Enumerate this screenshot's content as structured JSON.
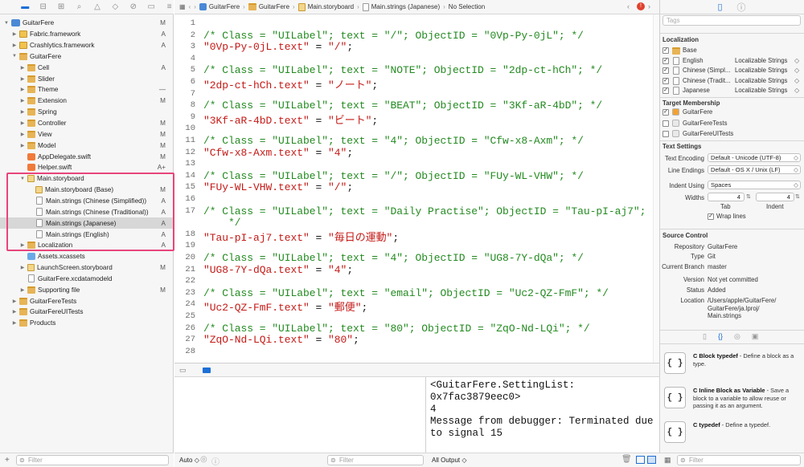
{
  "navigator": {
    "rows": [
      {
        "label": "GuitarFere",
        "badge": "M",
        "kind": "proj",
        "indent": 0,
        "disclosure": "open"
      },
      {
        "label": "Fabric.framework",
        "badge": "A",
        "kind": "fw",
        "indent": 1,
        "disclosure": "closed"
      },
      {
        "label": "Crashlytics.framework",
        "badge": "A",
        "kind": "fw",
        "indent": 1,
        "disclosure": "closed"
      },
      {
        "label": "GuitarFere",
        "badge": "",
        "kind": "folder",
        "indent": 1,
        "disclosure": "open"
      },
      {
        "label": "Cell",
        "badge": "A",
        "kind": "folder",
        "indent": 2,
        "disclosure": "closed"
      },
      {
        "label": "Slider",
        "badge": "",
        "kind": "folder",
        "indent": 2,
        "disclosure": "closed"
      },
      {
        "label": "Theme",
        "badge": "—",
        "kind": "folder",
        "indent": 2,
        "disclosure": "closed"
      },
      {
        "label": "Extension",
        "badge": "M",
        "kind": "folder",
        "indent": 2,
        "disclosure": "closed"
      },
      {
        "label": "Spring",
        "badge": "",
        "kind": "folder",
        "indent": 2,
        "disclosure": "closed"
      },
      {
        "label": "Controller",
        "badge": "M",
        "kind": "folder",
        "indent": 2,
        "disclosure": "closed"
      },
      {
        "label": "View",
        "badge": "M",
        "kind": "folder",
        "indent": 2,
        "disclosure": "closed"
      },
      {
        "label": "Model",
        "badge": "M",
        "kind": "folder",
        "indent": 2,
        "disclosure": "closed"
      },
      {
        "label": "AppDelegate.swift",
        "badge": "M",
        "kind": "swift",
        "indent": 2,
        "disclosure": ""
      },
      {
        "label": "Helper.swift",
        "badge": "A+",
        "kind": "swift",
        "indent": 2,
        "disclosure": ""
      },
      {
        "label": "Main.storyboard",
        "badge": "",
        "kind": "sb",
        "indent": 2,
        "disclosure": "open"
      },
      {
        "label": "Main.storyboard (Base)",
        "badge": "M",
        "kind": "sb",
        "indent": 3,
        "disclosure": ""
      },
      {
        "label": "Main.strings (Chinese (Simplified))",
        "badge": "A",
        "kind": "file",
        "indent": 3,
        "disclosure": ""
      },
      {
        "label": "Main.strings (Chinese (Traditional))",
        "badge": "A",
        "kind": "file",
        "indent": 3,
        "disclosure": ""
      },
      {
        "label": "Main.strings (Japanese)",
        "badge": "A",
        "kind": "file",
        "indent": 3,
        "disclosure": "",
        "selected": true
      },
      {
        "label": "Main.strings (English)",
        "badge": "A",
        "kind": "file",
        "indent": 3,
        "disclosure": ""
      },
      {
        "label": "Localization",
        "badge": "A",
        "kind": "folder",
        "indent": 2,
        "disclosure": "closed"
      },
      {
        "label": "Assets.xcassets",
        "badge": "",
        "kind": "xcass",
        "indent": 2,
        "disclosure": ""
      },
      {
        "label": "LaunchScreen.storyboard",
        "badge": "M",
        "kind": "sb",
        "indent": 2,
        "disclosure": "closed"
      },
      {
        "label": "GuitarFere.xcdatamodeld",
        "badge": "",
        "kind": "file",
        "indent": 2,
        "disclosure": ""
      },
      {
        "label": "Supporting file",
        "badge": "M",
        "kind": "folder",
        "indent": 2,
        "disclosure": "closed"
      },
      {
        "label": "GuitarFereTests",
        "badge": "",
        "kind": "folder",
        "indent": 1,
        "disclosure": "closed"
      },
      {
        "label": "GuitarFereUITests",
        "badge": "",
        "kind": "folder",
        "indent": 1,
        "disclosure": "closed"
      },
      {
        "label": "Products",
        "badge": "",
        "kind": "folder",
        "indent": 1,
        "disclosure": "closed"
      }
    ],
    "filter_placeholder": "Filter"
  },
  "jumpbar": {
    "items": [
      "GuitarFere",
      "GuitarFere",
      "Main.storyboard",
      "Main.strings (Japanese)",
      "No Selection"
    ]
  },
  "editor": {
    "lines": [
      {
        "n": "1",
        "parts": []
      },
      {
        "n": "2",
        "parts": [
          {
            "t": "/* Class = \"UILabel\"; text = \"/\"; ObjectID = \"0Vp-Py-0jL\"; */",
            "c": "com"
          }
        ]
      },
      {
        "n": "3",
        "parts": [
          {
            "t": "\"0Vp-Py-0jL.text\"",
            "c": "str"
          },
          {
            "t": " = ",
            "c": "pl"
          },
          {
            "t": "\"/\"",
            "c": "str"
          },
          {
            "t": ";",
            "c": "pl"
          }
        ]
      },
      {
        "n": "4",
        "parts": []
      },
      {
        "n": "5",
        "parts": [
          {
            "t": "/* Class = \"UILabel\"; text = \"NOTE\"; ObjectID = \"2dp-ct-hCh\"; */",
            "c": "com"
          }
        ]
      },
      {
        "n": "6",
        "parts": [
          {
            "t": "\"2dp-ct-hCh.text\"",
            "c": "str"
          },
          {
            "t": " = ",
            "c": "pl"
          },
          {
            "t": "\"ノート\"",
            "c": "str"
          },
          {
            "t": ";",
            "c": "pl"
          }
        ]
      },
      {
        "n": "7",
        "parts": []
      },
      {
        "n": "8",
        "parts": [
          {
            "t": "/* Class = \"UILabel\"; text = \"BEAT\"; ObjectID = \"3Kf-aR-4bD\"; */",
            "c": "com"
          }
        ]
      },
      {
        "n": "9",
        "parts": [
          {
            "t": "\"3Kf-aR-4bD.text\"",
            "c": "str"
          },
          {
            "t": " = ",
            "c": "pl"
          },
          {
            "t": "\"ビート\"",
            "c": "str"
          },
          {
            "t": ";",
            "c": "pl"
          }
        ]
      },
      {
        "n": "10",
        "parts": []
      },
      {
        "n": "11",
        "parts": [
          {
            "t": "/* Class = \"UILabel\"; text = \"4\"; ObjectID = \"Cfw-x8-Axm\"; */",
            "c": "com"
          }
        ]
      },
      {
        "n": "12",
        "parts": [
          {
            "t": "\"Cfw-x8-Axm.text\"",
            "c": "str"
          },
          {
            "t": " = ",
            "c": "pl"
          },
          {
            "t": "\"4\"",
            "c": "str"
          },
          {
            "t": ";",
            "c": "pl"
          }
        ]
      },
      {
        "n": "13",
        "parts": []
      },
      {
        "n": "14",
        "parts": [
          {
            "t": "/* Class = \"UILabel\"; text = \"/\"; ObjectID = \"FUy-WL-VHW\"; */",
            "c": "com"
          }
        ]
      },
      {
        "n": "15",
        "parts": [
          {
            "t": "\"FUy-WL-VHW.text\"",
            "c": "str"
          },
          {
            "t": " = ",
            "c": "pl"
          },
          {
            "t": "\"/\"",
            "c": "str"
          },
          {
            "t": ";",
            "c": "pl"
          }
        ]
      },
      {
        "n": "16",
        "parts": []
      },
      {
        "n": "17",
        "parts": [
          {
            "t": "/* Class = \"UILabel\"; text = \"Daily Practise\"; ObjectID = \"Tau-pI-aj7\";",
            "c": "com"
          }
        ]
      },
      {
        "n": "",
        "parts": [
          {
            "t": "    */",
            "c": "com"
          }
        ]
      },
      {
        "n": "18",
        "parts": [
          {
            "t": "\"Tau-pI-aj7.text\"",
            "c": "str"
          },
          {
            "t": " = ",
            "c": "pl"
          },
          {
            "t": "\"毎日の運動\"",
            "c": "str"
          },
          {
            "t": ";",
            "c": "pl"
          }
        ]
      },
      {
        "n": "19",
        "parts": []
      },
      {
        "n": "20",
        "parts": [
          {
            "t": "/* Class = \"UILabel\"; text = \"4\"; ObjectID = \"UG8-7Y-dQa\"; */",
            "c": "com"
          }
        ]
      },
      {
        "n": "21",
        "parts": [
          {
            "t": "\"UG8-7Y-dQa.text\"",
            "c": "str"
          },
          {
            "t": " = ",
            "c": "pl"
          },
          {
            "t": "\"4\"",
            "c": "str"
          },
          {
            "t": ";",
            "c": "pl"
          }
        ]
      },
      {
        "n": "22",
        "parts": []
      },
      {
        "n": "23",
        "parts": [
          {
            "t": "/* Class = \"UILabel\"; text = \"email\"; ObjectID = \"Uc2-QZ-FmF\"; */",
            "c": "com"
          }
        ]
      },
      {
        "n": "24",
        "parts": [
          {
            "t": "\"Uc2-QZ-FmF.text\"",
            "c": "str"
          },
          {
            "t": " = ",
            "c": "pl"
          },
          {
            "t": "\"郵便\"",
            "c": "str"
          },
          {
            "t": ";",
            "c": "pl"
          }
        ]
      },
      {
        "n": "25",
        "parts": []
      },
      {
        "n": "26",
        "parts": [
          {
            "t": "/* Class = \"UILabel\"; text = \"80\"; ObjectID = \"ZqO-Nd-LQi\"; */",
            "c": "com"
          }
        ]
      },
      {
        "n": "27",
        "parts": [
          {
            "t": "\"ZqO-Nd-LQi.text\"",
            "c": "str"
          },
          {
            "t": " = ",
            "c": "pl"
          },
          {
            "t": "\"80\"",
            "c": "str"
          },
          {
            "t": ";",
            "c": "pl"
          }
        ]
      },
      {
        "n": "28",
        "parts": []
      }
    ]
  },
  "debug": {
    "console_text": "<GuitarFere.SettingList:\n0x7fac3879eec0>\n4\nMessage from debugger: Terminated due\nto signal 15",
    "auto_label": "Auto",
    "filter_placeholder": "Filter",
    "output_label": "All Output"
  },
  "inspector": {
    "tags_placeholder": "Tags",
    "localization": {
      "title": "Localization",
      "rows": [
        {
          "name": "Base",
          "type": "",
          "checked": true
        },
        {
          "name": "English",
          "type": "Localizable Strings",
          "checked": true
        },
        {
          "name": "Chinese (Simpl...",
          "type": "Localizable Strings",
          "checked": true
        },
        {
          "name": "Chinese (Tradit...",
          "type": "Localizable Strings",
          "checked": true
        },
        {
          "name": "Japanese",
          "type": "Localizable Strings",
          "checked": true
        }
      ]
    },
    "target": {
      "title": "Target Membership",
      "rows": [
        {
          "name": "GuitarFere",
          "checked": true
        },
        {
          "name": "GuitarFereTests",
          "checked": false
        },
        {
          "name": "GuitarFereUITests",
          "checked": false
        }
      ]
    },
    "text_settings": {
      "title": "Text Settings",
      "encoding_label": "Text Encoding",
      "encoding_value": "Default - Unicode (UTF-8)",
      "endings_label": "Line Endings",
      "endings_value": "Default - OS X / Unix (LF)",
      "indent_label": "Indent Using",
      "indent_value": "Spaces",
      "widths_label": "Widths",
      "tab_value": "4",
      "indent_width_value": "4",
      "tab_label": "Tab",
      "indent_sub_label": "Indent",
      "wrap_label": "Wrap lines"
    },
    "source_control": {
      "title": "Source Control",
      "rows": [
        {
          "k": "Repository",
          "v": "GuitarFere"
        },
        {
          "k": "Type",
          "v": "Git"
        },
        {
          "k": "Current Branch",
          "v": "master"
        },
        {
          "k": "Version",
          "v": "Not yet committed"
        },
        {
          "k": "Status",
          "v": "Added"
        },
        {
          "k": "Location",
          "v": "/Users/apple/GuitarFere/\nGuitarFere/ja.lproj/\nMain.strings"
        }
      ]
    },
    "library": [
      {
        "icon": "{ }",
        "title": "C Block typedef",
        "desc": " - Define a block as a type."
      },
      {
        "icon": "{ }",
        "title": "C Inline Block as Variable",
        "desc": " - Save a block to a variable to allow reuse or passing it as an argument."
      },
      {
        "icon": "{ }",
        "title": "C typedef",
        "desc": " - Define a typedef."
      }
    ],
    "filter_placeholder": "Filter"
  },
  "colors": {
    "selection_outline": "#e8457a",
    "comment": "#238a20",
    "string": "#c41a16",
    "accent": "#1d6fd6"
  }
}
